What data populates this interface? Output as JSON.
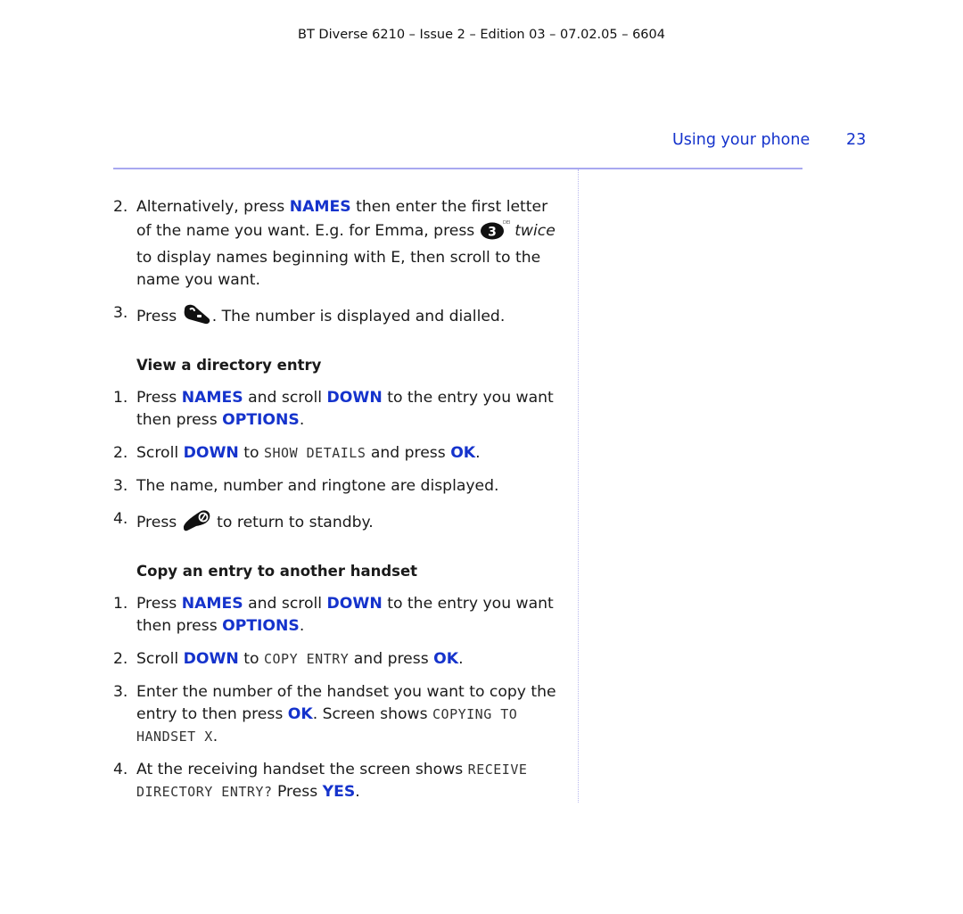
{
  "header": {
    "doc_info": "BT Diverse 6210 – Issue 2 – Edition 03 – 07.02.05 – 6604",
    "section_title": "Using your phone",
    "page_number": "23"
  },
  "colors": {
    "accent": "#1533cc",
    "rule": "#a8a8f0"
  },
  "intro_steps": [
    {
      "num": "2.",
      "parts": [
        "Alternatively, press ",
        "NAMES",
        " then enter the first letter of the name you want. E.g. for Emma, press ",
        "twice",
        " to display names beginning with E, then scroll to the name you want."
      ],
      "icon": "key-3-def-icon"
    },
    {
      "num": "3.",
      "parts": [
        "Press ",
        ". The number is displayed and dialled."
      ],
      "icon": "talk-key-icon"
    }
  ],
  "view_section": {
    "heading": "View a directory entry",
    "steps": [
      {
        "num": "1.",
        "t1": "Press ",
        "k1": "NAMES",
        "t2": " and scroll ",
        "k2": "DOWN",
        "t3": " to the entry you want then press ",
        "k3": "OPTIONS",
        "t4": "."
      },
      {
        "num": "2.",
        "t1": "Scroll ",
        "k1": "DOWN",
        "t2": " to ",
        "lcd": "SHOW DETAILS",
        "t3": " and press ",
        "k2": "OK",
        "t4": "."
      },
      {
        "num": "3.",
        "text": "The name, number and ringtone are displayed."
      },
      {
        "num": "4.",
        "t1": "Press ",
        "t2": " to return to standby.",
        "icon": "end-call-key-icon"
      }
    ]
  },
  "copy_section": {
    "heading": "Copy an entry to another handset",
    "steps": [
      {
        "num": "1.",
        "t1": "Press ",
        "k1": "NAMES",
        "t2": " and scroll ",
        "k2": "DOWN",
        "t3": " to the entry you want then press ",
        "k3": "OPTIONS",
        "t4": "."
      },
      {
        "num": "2.",
        "t1": "Scroll ",
        "k1": "DOWN",
        "t2": " to ",
        "lcd": "COPY ENTRY",
        "t3": " and press ",
        "k2": "OK",
        "t4": "."
      },
      {
        "num": "3.",
        "t1": "Enter the number of the handset you want to copy the entry to then press ",
        "k1": "OK",
        "t2": ". Screen shows ",
        "lcd": "COPYING TO HANDSET X",
        "t3": "."
      },
      {
        "num": "4.",
        "t1": "At the receiving handset the screen shows ",
        "lcd": "RECEIVE DIRECTORY ENTRY?",
        "t2": " Press ",
        "k1": "YES",
        "t3": "."
      }
    ]
  }
}
